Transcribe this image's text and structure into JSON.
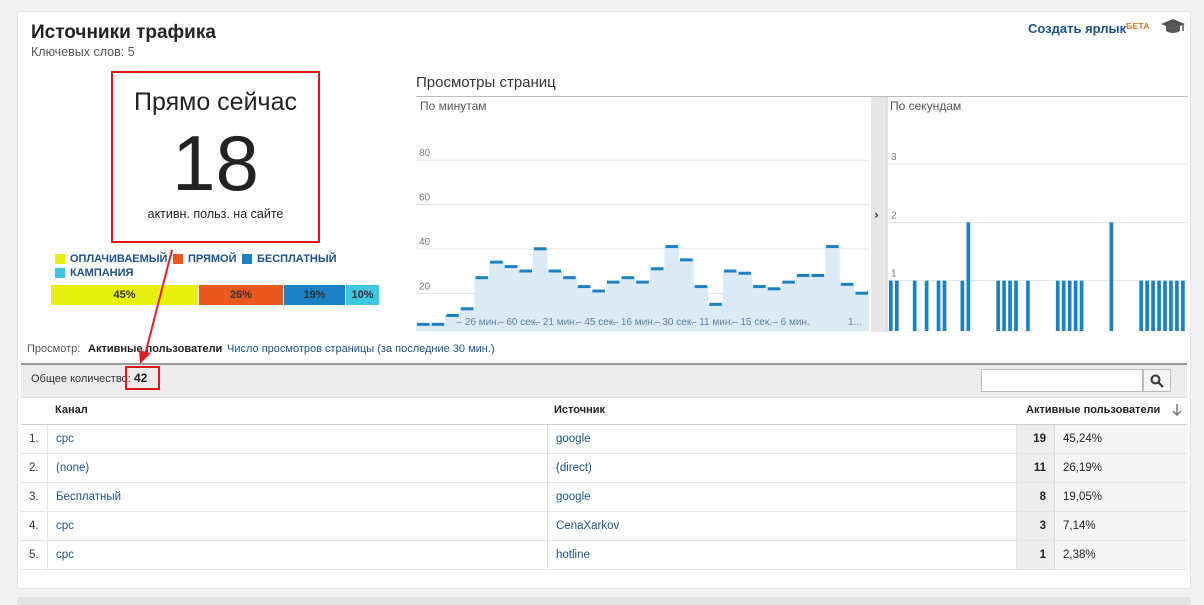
{
  "header": {
    "title": "Источники трафика",
    "subtitle": "Ключевых слов: 5",
    "create_label": "Создать ярлык",
    "beta_label": "БЕТА"
  },
  "now": {
    "title": "Прямо сейчас",
    "value": "18",
    "caption": "активн. польз. на сайте"
  },
  "legend": [
    {
      "label": "ОПЛАЧИВАЕМЫЙ",
      "color": "#e8f00f"
    },
    {
      "label": "ПРЯМОЙ",
      "color": "#e9581c"
    },
    {
      "label": "БЕСПЛАТНЫЙ",
      "color": "#1a82c4"
    },
    {
      "label": "КАМПАНИЯ",
      "color": "#3fc6e0"
    }
  ],
  "share_bar": [
    {
      "label": "45%",
      "value": 45,
      "color": "#e8f00f"
    },
    {
      "label": "26%",
      "value": 26,
      "color": "#e9581c"
    },
    {
      "label": "19%",
      "value": 19,
      "color": "#1a82c4"
    },
    {
      "label": "10%",
      "value": 10,
      "color": "#3fc6e0"
    }
  ],
  "pageviews": {
    "title": "Просмотры страниц",
    "minutes_label": "По минутам",
    "seconds_label": "По секундам"
  },
  "chart_data": [
    {
      "type": "area",
      "title": "По минутам",
      "y_ticks": [
        "80",
        "60",
        "40",
        "20"
      ],
      "x_ticks": [
        "– 26 мин.",
        "– 21 мин.",
        "– 16 мин.",
        "– 11 мин.",
        "– 6 мин.",
        "1..."
      ],
      "ylim": [
        0,
        90
      ],
      "values": [
        3,
        3,
        7,
        10,
        24,
        31,
        29,
        27,
        37,
        27,
        24,
        20,
        18,
        22,
        24,
        22,
        28,
        38,
        32,
        20,
        12,
        27,
        26,
        20,
        19,
        22,
        25,
        25,
        38,
        21,
        17
      ],
      "color": "#1a82c4"
    },
    {
      "type": "bar",
      "title": "По секундам",
      "y_ticks": [
        "3",
        "2",
        "1"
      ],
      "x_ticks": [
        "– 60 сек.",
        "– 45 сек.",
        "– 30 сек.",
        "– 15 сек."
      ],
      "ylim": [
        0,
        3
      ],
      "values": [
        1,
        1,
        0,
        0,
        1,
        0,
        1,
        0,
        1,
        1,
        0,
        0,
        1,
        2,
        0,
        0,
        0,
        0,
        1,
        1,
        1,
        1,
        0,
        1,
        0,
        0,
        0,
        0,
        1,
        1,
        1,
        1,
        1,
        0,
        0,
        0,
        0,
        2,
        0,
        0,
        0,
        0,
        1,
        1,
        1,
        1,
        1,
        1,
        1,
        1
      ],
      "color": "#1a82c4"
    }
  ],
  "view": {
    "label": "Просмотр:",
    "active_option": "Активные пользователи",
    "other_option": "Число просмотров страницы (за последние 30 мин.)"
  },
  "totals": {
    "label": "Общее количество:",
    "value": "42"
  },
  "search": {
    "placeholder": ""
  },
  "table": {
    "headers": {
      "channel": "Канал",
      "source": "Источник",
      "active": "Активные пользователи"
    },
    "rows": [
      {
        "n": "1.",
        "channel": "cpc",
        "source": "google",
        "value": "19",
        "pct": "45,24%"
      },
      {
        "n": "2.",
        "channel": "(none)",
        "source": "(direct)",
        "value": "11",
        "pct": "26,19%"
      },
      {
        "n": "3.",
        "channel": "Бесплатный",
        "source": "google",
        "value": "8",
        "pct": "19,05%"
      },
      {
        "n": "4.",
        "channel": "cpc",
        "source": "CenaXarkov",
        "value": "3",
        "pct": "7,14%"
      },
      {
        "n": "5.",
        "channel": "cpc",
        "source": "hotline",
        "value": "1",
        "pct": "2,38%"
      }
    ]
  }
}
